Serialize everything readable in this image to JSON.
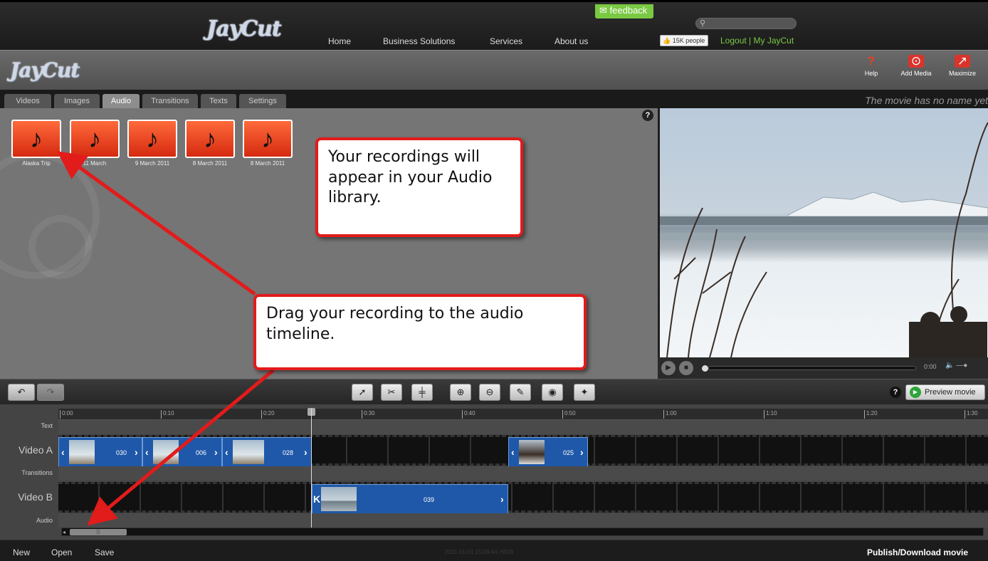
{
  "top_nav": {
    "logo": "JayCut",
    "links": [
      "Home",
      "Business Solutions",
      "Services",
      "About us"
    ],
    "feedback": "feedback",
    "search_placeholder": "",
    "like_count": "15K people",
    "account": "Logout | My JayCut"
  },
  "app_header": {
    "logo": "JayCut",
    "help": "Help",
    "add_media": "Add Media",
    "maximize": "Maximize"
  },
  "tabs": {
    "items": [
      "Videos",
      "Images",
      "Audio",
      "Transitions",
      "Texts",
      "Settings"
    ],
    "active": "Audio"
  },
  "movie_name": "The movie has no name yet",
  "library": {
    "items": [
      "Alaska Trip",
      "11 March",
      "9 March 2011",
      "8 March 2011",
      "8 March 2011"
    ],
    "help": "?"
  },
  "player": {
    "time": "0:00"
  },
  "toolbar": {
    "help": "?",
    "preview_movie": "Preview movie"
  },
  "timeline": {
    "ruler_ticks": [
      "0:00",
      "0:10",
      "0:20",
      "0:30",
      "0:40",
      "0:50",
      "1:00",
      "1:10",
      "1:20",
      "1:30"
    ],
    "rows": {
      "text": "Text",
      "video_a": "Video A",
      "transitions": "Transitions",
      "video_b": "Video B",
      "audio": "Audio"
    },
    "video_a_clips": [
      "030",
      "006",
      "028",
      "025"
    ],
    "video_b_clips": [
      "039"
    ]
  },
  "bottom_bar": {
    "new": "New",
    "open": "Open",
    "save": "Save",
    "stamp": "2011-01-01 15:08:44 r6929",
    "publish": "Publish/Download movie"
  },
  "callouts": {
    "library": "Your recordings will appear in your Audio library.",
    "timeline": "Drag your recording to the audio timeline."
  },
  "colors": {
    "accent_green": "#7ac943",
    "audio_tile": "#e8401c",
    "clip_blue": "#1f58a8",
    "callout_border": "#e21b1b"
  }
}
